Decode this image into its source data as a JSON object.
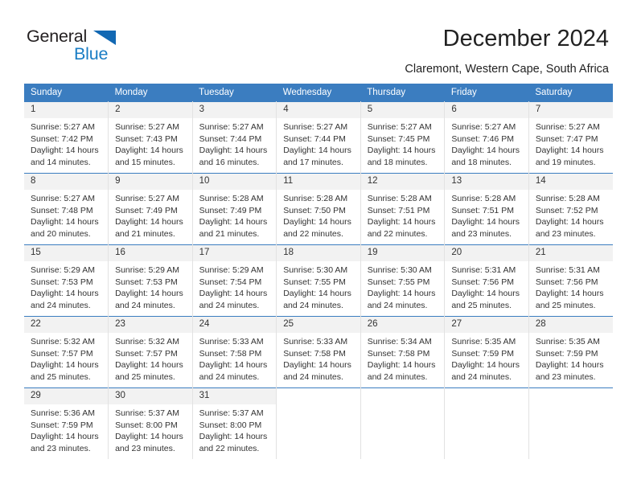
{
  "brand": {
    "name_part1": "General",
    "name_part2": "Blue"
  },
  "header": {
    "title": "December 2024",
    "location": "Claremont, Western Cape, South Africa"
  },
  "colors": {
    "header_blue": "#3b7dc0",
    "logo_blue": "#1a7dc4",
    "daynum_bg": "#f2f2f2",
    "cell_border": "#e2e2e2"
  },
  "weekdays": [
    "Sunday",
    "Monday",
    "Tuesday",
    "Wednesday",
    "Thursday",
    "Friday",
    "Saturday"
  ],
  "weeks": [
    [
      {
        "day": "1",
        "sunrise": "Sunrise: 5:27 AM",
        "sunset": "Sunset: 7:42 PM",
        "daylight1": "Daylight: 14 hours",
        "daylight2": "and 14 minutes."
      },
      {
        "day": "2",
        "sunrise": "Sunrise: 5:27 AM",
        "sunset": "Sunset: 7:43 PM",
        "daylight1": "Daylight: 14 hours",
        "daylight2": "and 15 minutes."
      },
      {
        "day": "3",
        "sunrise": "Sunrise: 5:27 AM",
        "sunset": "Sunset: 7:44 PM",
        "daylight1": "Daylight: 14 hours",
        "daylight2": "and 16 minutes."
      },
      {
        "day": "4",
        "sunrise": "Sunrise: 5:27 AM",
        "sunset": "Sunset: 7:44 PM",
        "daylight1": "Daylight: 14 hours",
        "daylight2": "and 17 minutes."
      },
      {
        "day": "5",
        "sunrise": "Sunrise: 5:27 AM",
        "sunset": "Sunset: 7:45 PM",
        "daylight1": "Daylight: 14 hours",
        "daylight2": "and 18 minutes."
      },
      {
        "day": "6",
        "sunrise": "Sunrise: 5:27 AM",
        "sunset": "Sunset: 7:46 PM",
        "daylight1": "Daylight: 14 hours",
        "daylight2": "and 18 minutes."
      },
      {
        "day": "7",
        "sunrise": "Sunrise: 5:27 AM",
        "sunset": "Sunset: 7:47 PM",
        "daylight1": "Daylight: 14 hours",
        "daylight2": "and 19 minutes."
      }
    ],
    [
      {
        "day": "8",
        "sunrise": "Sunrise: 5:27 AM",
        "sunset": "Sunset: 7:48 PM",
        "daylight1": "Daylight: 14 hours",
        "daylight2": "and 20 minutes."
      },
      {
        "day": "9",
        "sunrise": "Sunrise: 5:27 AM",
        "sunset": "Sunset: 7:49 PM",
        "daylight1": "Daylight: 14 hours",
        "daylight2": "and 21 minutes."
      },
      {
        "day": "10",
        "sunrise": "Sunrise: 5:28 AM",
        "sunset": "Sunset: 7:49 PM",
        "daylight1": "Daylight: 14 hours",
        "daylight2": "and 21 minutes."
      },
      {
        "day": "11",
        "sunrise": "Sunrise: 5:28 AM",
        "sunset": "Sunset: 7:50 PM",
        "daylight1": "Daylight: 14 hours",
        "daylight2": "and 22 minutes."
      },
      {
        "day": "12",
        "sunrise": "Sunrise: 5:28 AM",
        "sunset": "Sunset: 7:51 PM",
        "daylight1": "Daylight: 14 hours",
        "daylight2": "and 22 minutes."
      },
      {
        "day": "13",
        "sunrise": "Sunrise: 5:28 AM",
        "sunset": "Sunset: 7:51 PM",
        "daylight1": "Daylight: 14 hours",
        "daylight2": "and 23 minutes."
      },
      {
        "day": "14",
        "sunrise": "Sunrise: 5:28 AM",
        "sunset": "Sunset: 7:52 PM",
        "daylight1": "Daylight: 14 hours",
        "daylight2": "and 23 minutes."
      }
    ],
    [
      {
        "day": "15",
        "sunrise": "Sunrise: 5:29 AM",
        "sunset": "Sunset: 7:53 PM",
        "daylight1": "Daylight: 14 hours",
        "daylight2": "and 24 minutes."
      },
      {
        "day": "16",
        "sunrise": "Sunrise: 5:29 AM",
        "sunset": "Sunset: 7:53 PM",
        "daylight1": "Daylight: 14 hours",
        "daylight2": "and 24 minutes."
      },
      {
        "day": "17",
        "sunrise": "Sunrise: 5:29 AM",
        "sunset": "Sunset: 7:54 PM",
        "daylight1": "Daylight: 14 hours",
        "daylight2": "and 24 minutes."
      },
      {
        "day": "18",
        "sunrise": "Sunrise: 5:30 AM",
        "sunset": "Sunset: 7:55 PM",
        "daylight1": "Daylight: 14 hours",
        "daylight2": "and 24 minutes."
      },
      {
        "day": "19",
        "sunrise": "Sunrise: 5:30 AM",
        "sunset": "Sunset: 7:55 PM",
        "daylight1": "Daylight: 14 hours",
        "daylight2": "and 24 minutes."
      },
      {
        "day": "20",
        "sunrise": "Sunrise: 5:31 AM",
        "sunset": "Sunset: 7:56 PM",
        "daylight1": "Daylight: 14 hours",
        "daylight2": "and 25 minutes."
      },
      {
        "day": "21",
        "sunrise": "Sunrise: 5:31 AM",
        "sunset": "Sunset: 7:56 PM",
        "daylight1": "Daylight: 14 hours",
        "daylight2": "and 25 minutes."
      }
    ],
    [
      {
        "day": "22",
        "sunrise": "Sunrise: 5:32 AM",
        "sunset": "Sunset: 7:57 PM",
        "daylight1": "Daylight: 14 hours",
        "daylight2": "and 25 minutes."
      },
      {
        "day": "23",
        "sunrise": "Sunrise: 5:32 AM",
        "sunset": "Sunset: 7:57 PM",
        "daylight1": "Daylight: 14 hours",
        "daylight2": "and 25 minutes."
      },
      {
        "day": "24",
        "sunrise": "Sunrise: 5:33 AM",
        "sunset": "Sunset: 7:58 PM",
        "daylight1": "Daylight: 14 hours",
        "daylight2": "and 24 minutes."
      },
      {
        "day": "25",
        "sunrise": "Sunrise: 5:33 AM",
        "sunset": "Sunset: 7:58 PM",
        "daylight1": "Daylight: 14 hours",
        "daylight2": "and 24 minutes."
      },
      {
        "day": "26",
        "sunrise": "Sunrise: 5:34 AM",
        "sunset": "Sunset: 7:58 PM",
        "daylight1": "Daylight: 14 hours",
        "daylight2": "and 24 minutes."
      },
      {
        "day": "27",
        "sunrise": "Sunrise: 5:35 AM",
        "sunset": "Sunset: 7:59 PM",
        "daylight1": "Daylight: 14 hours",
        "daylight2": "and 24 minutes."
      },
      {
        "day": "28",
        "sunrise": "Sunrise: 5:35 AM",
        "sunset": "Sunset: 7:59 PM",
        "daylight1": "Daylight: 14 hours",
        "daylight2": "and 23 minutes."
      }
    ],
    [
      {
        "day": "29",
        "sunrise": "Sunrise: 5:36 AM",
        "sunset": "Sunset: 7:59 PM",
        "daylight1": "Daylight: 14 hours",
        "daylight2": "and 23 minutes."
      },
      {
        "day": "30",
        "sunrise": "Sunrise: 5:37 AM",
        "sunset": "Sunset: 8:00 PM",
        "daylight1": "Daylight: 14 hours",
        "daylight2": "and 23 minutes."
      },
      {
        "day": "31",
        "sunrise": "Sunrise: 5:37 AM",
        "sunset": "Sunset: 8:00 PM",
        "daylight1": "Daylight: 14 hours",
        "daylight2": "and 22 minutes."
      },
      {
        "day": "",
        "sunrise": "",
        "sunset": "",
        "daylight1": "",
        "daylight2": ""
      },
      {
        "day": "",
        "sunrise": "",
        "sunset": "",
        "daylight1": "",
        "daylight2": ""
      },
      {
        "day": "",
        "sunrise": "",
        "sunset": "",
        "daylight1": "",
        "daylight2": ""
      },
      {
        "day": "",
        "sunrise": "",
        "sunset": "",
        "daylight1": "",
        "daylight2": ""
      }
    ]
  ]
}
